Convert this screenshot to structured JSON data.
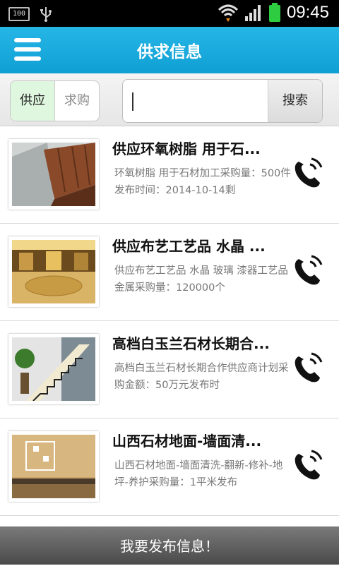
{
  "statusbar": {
    "battery_small": "100",
    "time": "09:45",
    "battery_color": "#2ecc40"
  },
  "header": {
    "title": "供求信息"
  },
  "filter": {
    "supply_label": "供应",
    "demand_label": "求购",
    "search_value": "",
    "search_button": "搜索"
  },
  "items": [
    {
      "title": "供应环氧树脂 用于石...",
      "desc": "环氧树脂 用于石材加工采购量：500件发布时间：2014-10-14剩"
    },
    {
      "title": "供应布艺工艺品 水晶 ...",
      "desc": "供应布艺工艺品 水晶 玻璃 漆器工艺品 金属采购量：120000个"
    },
    {
      "title": "高档白玉兰石材长期合...",
      "desc": "高档白玉兰石材长期合作供应商计划采购金额：50万元发布时"
    },
    {
      "title": "山西石材地面-墙面清...",
      "desc": "山西石材地面-墙面清洗-翻新-修补-地坪-养护采购量：1平米发布"
    }
  ],
  "bottom": {
    "publish_label": "我要发布信息！"
  }
}
